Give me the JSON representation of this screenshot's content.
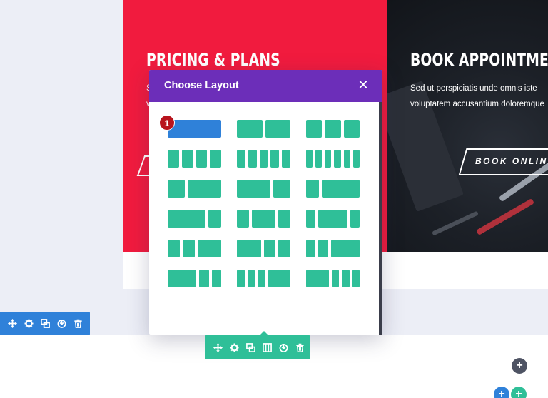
{
  "hero": {
    "pricing_heading": "PRICING & PLANS",
    "pricing_text_1": "S",
    "pricing_text_2": "v",
    "book_heading": "BOOK APPOINTMENT",
    "book_text_1": "Sed ut perspiciatis unde omnis iste",
    "book_text_2": "voluptatem accusantium doloremque",
    "book_button": "BOOK ONLINE"
  },
  "modal": {
    "title": "Choose Layout",
    "close_icon": "close-icon",
    "badge": "1",
    "selected_index": 0,
    "layouts": [
      "1",
      "1/2+1/2",
      "1/3+1/3+1/3",
      "1/4+1/4+1/4+1/4",
      "1/5x5",
      "1/6x6",
      "1/3+2/3",
      "2/3+1/3",
      "1/4+3/4",
      "3/4+1/4",
      "1/4+1/2+1/4",
      "1/5+3/5+1/5",
      "1/4+1/4+1/2",
      "1/2+1/4+1/4",
      "1/5+1/5+3/5",
      "3/5+1/5+1/5",
      "1/6+1/6+1/6+1/2",
      "1/2+1/6+1/6+1/6"
    ]
  },
  "row_toolbar": {
    "icons": [
      "move-icon",
      "settings-icon",
      "duplicate-icon",
      "save-icon",
      "delete-icon"
    ]
  },
  "module_toolbar": {
    "icons": [
      "move-icon",
      "settings-icon",
      "duplicate-icon",
      "columns-icon",
      "save-icon",
      "delete-icon"
    ]
  },
  "add_buttons": {
    "add_label": "+"
  },
  "colors": {
    "accent_red": "#f11b3e",
    "modal_header": "#6c2eb9",
    "layout_green": "#2fbf98",
    "layout_selected": "#2f81d9",
    "row_toolbar": "#2f81d9",
    "badge_red": "#b8141d",
    "dark_button": "#4e5363"
  }
}
